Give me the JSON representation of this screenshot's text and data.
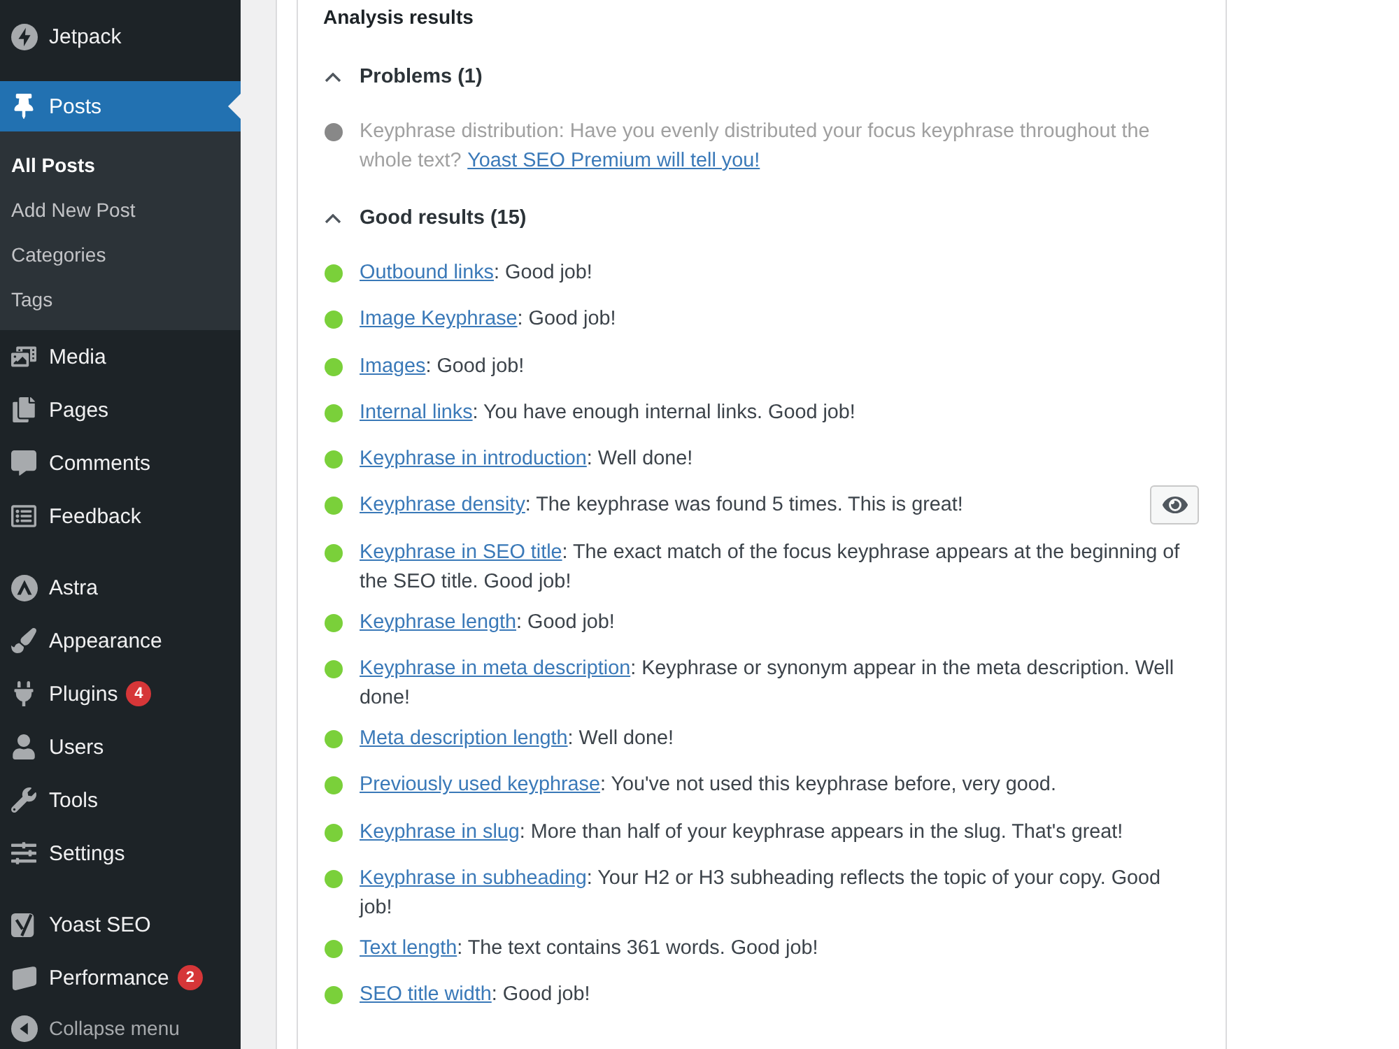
{
  "sidebar": {
    "groups": [
      {
        "items": [
          {
            "label": "Jetpack",
            "selected": false
          }
        ]
      },
      {
        "items": [
          {
            "label": "Posts",
            "selected": true,
            "submenu": [
              {
                "label": "All Posts",
                "selected": true
              },
              {
                "label": "Add New Post",
                "selected": false
              },
              {
                "label": "Categories",
                "selected": false
              },
              {
                "label": "Tags",
                "selected": false
              }
            ]
          },
          {
            "label": "Media",
            "selected": false
          },
          {
            "label": "Pages",
            "selected": false
          },
          {
            "label": "Comments",
            "selected": false
          },
          {
            "label": "Feedback",
            "selected": false
          }
        ]
      },
      {
        "items": [
          {
            "label": "Astra",
            "selected": false
          },
          {
            "label": "Appearance",
            "selected": false
          },
          {
            "label": "Plugins",
            "selected": false,
            "badge": "4"
          },
          {
            "label": "Users",
            "selected": false
          },
          {
            "label": "Tools",
            "selected": false
          },
          {
            "label": "Settings",
            "selected": false
          }
        ]
      },
      {
        "items": [
          {
            "label": "Yoast SEO",
            "selected": false
          },
          {
            "label": "Performance",
            "selected": false,
            "badge": "2"
          }
        ]
      }
    ],
    "collapse_label": "Collapse menu"
  },
  "analysis": {
    "title": "Analysis results",
    "sections": [
      {
        "title": "Problems (1)",
        "expanded": true,
        "items": [
          {
            "kind": "upsell",
            "color": "#888888",
            "text": "Keyphrase distribution: Have you evenly distributed your focus keyphrase throughout the whole text?",
            "link": "Yoast SEO Premium will tell you!"
          }
        ]
      },
      {
        "title": "Good results (15)",
        "expanded": true,
        "items": [
          {
            "kind": "result",
            "color": "#7ad03a",
            "link": "Outbound links",
            "text": ": Good job!"
          },
          {
            "kind": "result",
            "color": "#7ad03a",
            "link": "Image Keyphrase",
            "text": ": Good job!"
          },
          {
            "kind": "result",
            "color": "#7ad03a",
            "link": "Images",
            "text": ": Good job!"
          },
          {
            "kind": "result",
            "color": "#7ad03a",
            "link": "Internal links",
            "text": ": You have enough internal links. Good job!"
          },
          {
            "kind": "result",
            "color": "#7ad03a",
            "link": "Keyphrase in introduction",
            "text": ": Well done!"
          },
          {
            "kind": "result",
            "color": "#7ad03a",
            "link": "Keyphrase density",
            "text": ": The keyphrase was found 5 times. This is great!",
            "eye_button": true
          },
          {
            "kind": "result",
            "color": "#7ad03a",
            "link": "Keyphrase in SEO title",
            "text": ": The exact match of the focus keyphrase appears at the beginning of the SEO title. Good job!"
          },
          {
            "kind": "result",
            "color": "#7ad03a",
            "link": "Keyphrase length",
            "text": ": Good job!"
          },
          {
            "kind": "result",
            "color": "#7ad03a",
            "link": "Keyphrase in meta description",
            "text": ": Keyphrase or synonym appear in the meta description. Well done!"
          },
          {
            "kind": "result",
            "color": "#7ad03a",
            "link": "Meta description length",
            "text": ": Well done!"
          },
          {
            "kind": "result",
            "color": "#7ad03a",
            "link": "Previously used keyphrase",
            "text": ": You've not used this keyphrase before, very good."
          },
          {
            "kind": "result",
            "color": "#7ad03a",
            "link": "Keyphrase in slug",
            "text": ": More than half of your keyphrase appears in the slug. That's great!"
          },
          {
            "kind": "result",
            "color": "#7ad03a",
            "link": "Keyphrase in subheading",
            "text": ": Your H2 or H3 subheading reflects the topic of your copy. Good job!"
          },
          {
            "kind": "result",
            "color": "#7ad03a",
            "link": "Text length",
            "text": ": The text contains 361 words. Good job!"
          },
          {
            "kind": "result",
            "color": "#7ad03a",
            "link": "SEO title width",
            "text": ": Good job!"
          }
        ]
      }
    ]
  }
}
